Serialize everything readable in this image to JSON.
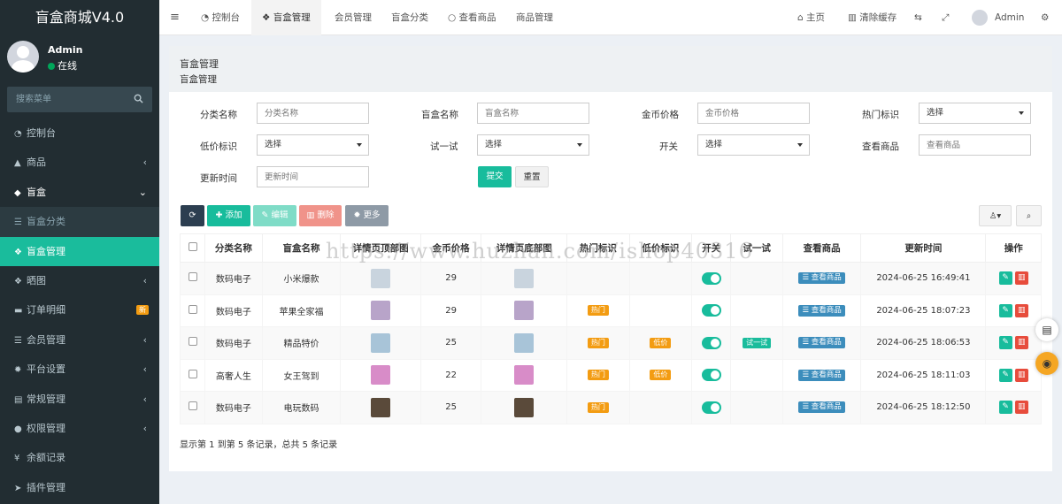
{
  "app": {
    "title": "盲盒商城V4.0"
  },
  "user": {
    "name": "Admin",
    "status": "在线"
  },
  "sidebar": {
    "search_placeholder": "搜索菜单",
    "items": [
      {
        "label": "控制台",
        "icon": "dashboard-icon"
      },
      {
        "label": "商品",
        "icon": "shop-icon",
        "arrow": "‹"
      },
      {
        "label": "盲盒",
        "icon": "cube-icon",
        "arrow": "⌄"
      },
      {
        "label": "盲盒分类",
        "icon": "list-icon"
      },
      {
        "label": "盲盒管理",
        "icon": "cubes-icon"
      },
      {
        "label": "晒图",
        "icon": "dropbox-icon",
        "arrow": "‹"
      },
      {
        "label": "订单明细",
        "icon": "cart-icon",
        "badge": "新"
      },
      {
        "label": "会员管理",
        "icon": "list-icon",
        "arrow": "‹"
      },
      {
        "label": "平台设置",
        "icon": "gear-icon",
        "arrow": "‹"
      },
      {
        "label": "常规管理",
        "icon": "database-icon",
        "arrow": "‹"
      },
      {
        "label": "权限管理",
        "icon": "group-icon",
        "arrow": "‹"
      },
      {
        "label": "余额记录",
        "icon": "yen-icon"
      },
      {
        "label": "插件管理",
        "icon": "rocket-icon"
      }
    ]
  },
  "topbar": {
    "menu_icon": "≡",
    "tabs": [
      {
        "label": "控制台"
      },
      {
        "label": "盲盒管理"
      },
      {
        "label": "会员管理"
      },
      {
        "label": "盲盒分类"
      },
      {
        "label": "查看商品"
      },
      {
        "label": "商品管理"
      }
    ],
    "home": "主页",
    "clear_cache": "清除缓存",
    "admin": "Admin"
  },
  "page": {
    "title": "盲盒管理",
    "subtitle": "盲盒管理"
  },
  "filters": {
    "category_label": "分类名称",
    "category_placeholder": "分类名称",
    "box_label": "盲盒名称",
    "box_placeholder": "盲盒名称",
    "gold_label": "金币价格",
    "gold_placeholder": "金币价格",
    "hot_label": "热门标识",
    "hot_value": "选择",
    "low_label": "低价标识",
    "low_value": "选择",
    "try_label": "试一试",
    "try_value": "选择",
    "switch_label": "开关",
    "switch_value": "选择",
    "view_label": "查看商品",
    "view_placeholder": "查看商品",
    "time_label": "更新时间",
    "time_placeholder": "更新时间",
    "submit": "提交",
    "reset": "重置"
  },
  "toolbar": {
    "add": "添加",
    "edit": "编辑",
    "delete": "删除",
    "more": "更多"
  },
  "table": {
    "headers": [
      "分类名称",
      "盲盒名称",
      "详情页顶部图",
      "金币价格",
      "详情页底部图",
      "热门标识",
      "低价标识",
      "开关",
      "试一试",
      "查看商品",
      "更新时间",
      "操作"
    ],
    "view_btn": "查看商品",
    "hot_tag": "热门",
    "low_tag": "低价",
    "try_tag": "试一试",
    "rows": [
      {
        "category": "数码电子",
        "name": "小米爆款",
        "price": "29",
        "hot": false,
        "low": false,
        "try": false,
        "time": "2024-06-25 16:49:41",
        "img": "#c9d4de"
      },
      {
        "category": "数码电子",
        "name": "苹果全家福",
        "price": "29",
        "hot": true,
        "low": false,
        "try": false,
        "time": "2024-06-25 18:07:23",
        "img": "#b8a4c9"
      },
      {
        "category": "数码电子",
        "name": "精品特价",
        "price": "25",
        "hot": true,
        "low": true,
        "try": true,
        "time": "2024-06-25 18:06:53",
        "img": "#a8c4d8"
      },
      {
        "category": "高奢人生",
        "name": "女王驾到",
        "price": "22",
        "hot": true,
        "low": true,
        "try": false,
        "time": "2024-06-25 18:11:03",
        "img": "#d88cc8"
      },
      {
        "category": "数码电子",
        "name": "电玩数码",
        "price": "25",
        "hot": true,
        "low": false,
        "try": false,
        "time": "2024-06-25 18:12:50",
        "img": "#5a4a3a"
      }
    ]
  },
  "pagination_text": "显示第 1 到第 5 条记录，总共 5 条记录",
  "watermark": "https://www.huzhan.com/ishop40316"
}
